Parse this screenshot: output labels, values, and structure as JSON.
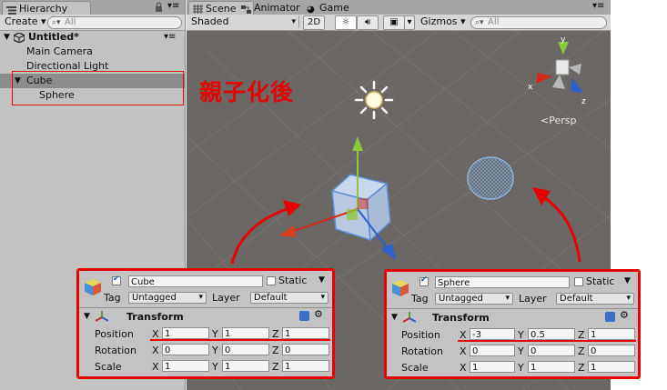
{
  "hierarchy": {
    "tab_label": "Hierarchy",
    "create_label": "Create",
    "search_placeholder": "All",
    "scene_name": "Untitled*",
    "items": [
      "Main Camera",
      "Directional Light",
      "Cube",
      "Sphere"
    ]
  },
  "scene_view": {
    "tabs": [
      "Scene",
      "Animator",
      "Game"
    ],
    "shading_mode": "Shaded",
    "mode_2d": "2D",
    "gizmos_label": "Gizmos",
    "search_placeholder": "All",
    "projection_label": "Persp",
    "axis_labels": [
      "y",
      "x",
      "z"
    ],
    "annotation": "親子化後"
  },
  "inspectors": [
    {
      "name": "Cube",
      "static_label": "Static",
      "tag_label": "Tag",
      "tag": "Untagged",
      "layer_label": "Layer",
      "layer": "Default",
      "component": "Transform",
      "rows": [
        {
          "label": "Position",
          "x": "1",
          "y": "1",
          "z": "1"
        },
        {
          "label": "Rotation",
          "x": "0",
          "y": "0",
          "z": "0"
        },
        {
          "label": "Scale",
          "x": "1",
          "y": "1",
          "z": "1"
        }
      ]
    },
    {
      "name": "Sphere",
      "static_label": "Static",
      "tag_label": "Tag",
      "tag": "Untagged",
      "layer_label": "Layer",
      "layer": "Default",
      "component": "Transform",
      "rows": [
        {
          "label": "Position",
          "x": "-3",
          "y": "0.5",
          "z": "1"
        },
        {
          "label": "Rotation",
          "x": "0",
          "y": "0",
          "z": "0"
        },
        {
          "label": "Scale",
          "x": "1",
          "y": "1",
          "z": "1"
        }
      ]
    }
  ],
  "axis_letters": [
    "X",
    "Y",
    "Z"
  ],
  "colors": {
    "highlight": "#e60000",
    "scene_bg": "#6a6764",
    "panel_bg": "#c2c2c2"
  }
}
